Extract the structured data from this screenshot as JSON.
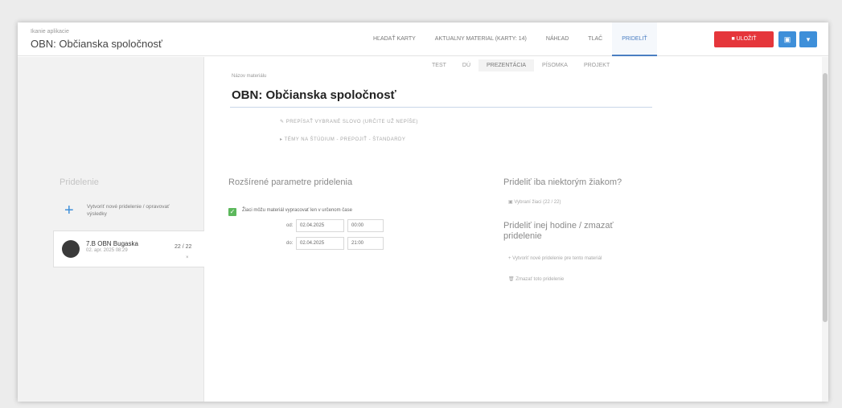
{
  "header": {
    "subtitle": "Ikanie aplikacie",
    "title": "OBN: Občianska spoločnosť"
  },
  "nav": {
    "items": [
      {
        "label": "HĽADAŤ KARTY",
        "active": false
      },
      {
        "label": "AKTUALNY MATERIAL (KARTY: 14)",
        "active": false
      },
      {
        "label": "NÁHĽAD",
        "active": false
      },
      {
        "label": "TLAČ",
        "active": false
      },
      {
        "label": "PRIDELIŤ",
        "active": true
      }
    ]
  },
  "actions": {
    "red_label": "■ ULOŽIŤ",
    "blue1_icon": "save-icon",
    "blue1_glyph": "▣",
    "blue2_icon": "chevron-down-icon",
    "blue2_glyph": "▾"
  },
  "tabs": [
    {
      "label": "TEST",
      "active": false
    },
    {
      "label": "DÚ",
      "active": false
    },
    {
      "label": "PREZENTÁCIA",
      "active": true
    },
    {
      "label": "PÍSOMKA",
      "active": false
    },
    {
      "label": "PROJEKT",
      "active": false
    }
  ],
  "material": {
    "label": "Názov materiálu",
    "title": "OBN: Občianska spoločnosť",
    "link1": "✎ PREPÍSAŤ VYBRANÉ SLOVO (URČITE UŽ NEPÍŠE)",
    "link2": "▸ TÉMY NA ŠTÚDIUM - PREPOJIŤ - ŠTANDARDY"
  },
  "left": {
    "heading": "Pridelenie",
    "create_text": "Vytvoriť nové pridelenie / opravovať výsledky",
    "card": {
      "name": "7.B OBN Bugaska",
      "date": "02. apr. 2025 08:29",
      "score": "22 / 22",
      "close": "×"
    }
  },
  "params": {
    "title": "Rozšírené parametre pridelenia",
    "checkbox_label": "Žiaci môžu materiál vypracovať len v určenom čase",
    "from_label": "od:",
    "from_date": "02.04.2025",
    "from_time": "00:00",
    "to_label": "do:",
    "to_date": "02.04.2025",
    "to_time": "21:00"
  },
  "right": {
    "title1": "Prideliť iba niektorým žiakom?",
    "item1": "▣ Vybraní žiaci (22 / 22)",
    "title2": "Prideliť inej hodine / zmazať pridelenie",
    "item2": "+ Vytvoriť nové pridelenie pre tento materiál",
    "item3": "🗑 Zmazať toto pridelenie"
  },
  "colors": {
    "accent": "#3e8fd9",
    "danger": "#e5363b",
    "success": "#5cb85c"
  }
}
